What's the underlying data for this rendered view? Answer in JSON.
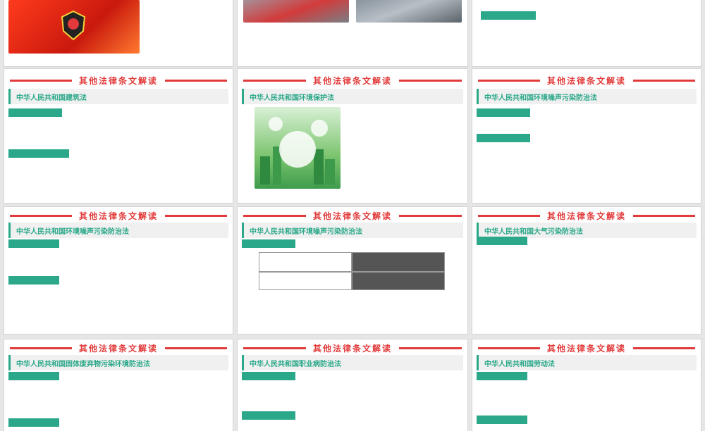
{
  "slides": {
    "r1c1": {
      "text": "",
      "signature": ""
    },
    "r1c2": {
      "caption": "",
      "text": ""
    },
    "r1c3": {
      "tag": "",
      "text": ""
    },
    "r2c1": {
      "title": "其他法律条文解读",
      "section": "中华人民共和国建筑法",
      "tag1": "",
      "text1": "",
      "tag2": "",
      "text2": ""
    },
    "r2c2": {
      "title": "其他法律条文解读",
      "section": "中华人民共和国环境保护法",
      "text": "",
      "signature": "",
      "image_label": ""
    },
    "r2c3": {
      "title": "其他法律条文解读",
      "section": "中华人民共和国环境噪声污染防治法",
      "tag1": "",
      "text1": "",
      "tag2": "",
      "text2": ""
    },
    "r3c1": {
      "title": "其他法律条文解读",
      "section": "中华人民共和国环境噪声污染防治法",
      "tag1": "",
      "text1": "",
      "tag2": "",
      "text2": ""
    },
    "r3c2": {
      "title": "其他法律条文解读",
      "section": "中华人民共和国环境噪声污染防治法",
      "tag": "",
      "table_headers": [
        "",
        ""
      ],
      "table_values": [
        "",
        ""
      ],
      "text": ""
    },
    "r3c3": {
      "title": "其他法律条文解读",
      "section": "中华人民共和国大气污染防治法",
      "tag": "",
      "text": "",
      "items": [
        "",
        "",
        "",
        ""
      ]
    },
    "r4c1": {
      "title": "其他法律条文解读",
      "section": "中华人民共和国固体废弃物污染环境防治法",
      "tag1": "",
      "text1": "",
      "tag2": ""
    },
    "r4c2": {
      "title": "其他法律条文解读",
      "section": "中华人民共和国职业病防治法",
      "tag1": "",
      "text1": "",
      "tag2": ""
    },
    "r4c3": {
      "title": "其他法律条文解读",
      "section": "中华人民共和国劳动法",
      "tag1": "",
      "text1": "",
      "tag2": ""
    }
  },
  "colors": {
    "accent_red": "#e23a3a",
    "accent_green": "#2aa889"
  }
}
